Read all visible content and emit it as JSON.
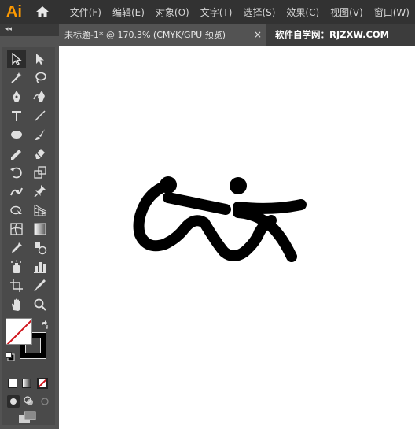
{
  "app": {
    "logo_text": "Ai",
    "home_icon": "home-icon"
  },
  "menu": [
    {
      "label": "文件(F)"
    },
    {
      "label": "编辑(E)"
    },
    {
      "label": "对象(O)"
    },
    {
      "label": "文字(T)"
    },
    {
      "label": "选择(S)"
    },
    {
      "label": "效果(C)"
    },
    {
      "label": "视图(V)"
    },
    {
      "label": "窗口(W)"
    }
  ],
  "panel": {
    "collapse_label": "◂◂"
  },
  "document_tab": {
    "title": "未标题-1* @ 170.3% (CMYK/GPU 预览)",
    "close": "×"
  },
  "watermark": {
    "text": "软件自学网：RJZXW.COM"
  },
  "colors": {
    "accent_logo": "#ff9a00",
    "menubar_bg": "#323232",
    "panel_bg": "#535353",
    "canvas_bg": "#ffffff",
    "stroke_none_red": "#d0131b",
    "artwork": "#000000"
  },
  "tools": [
    "selection-tool",
    "direct-selection-tool",
    "magic-wand-tool",
    "lasso-tool",
    "pen-tool",
    "curvature-tool",
    "type-tool",
    "line-segment-tool",
    "ellipse-tool",
    "paintbrush-tool",
    "shaper-tool",
    "eraser-tool",
    "rotate-tool",
    "scale-tool",
    "puppet-warp-tool",
    "pin-tool",
    "free-transform-tool",
    "perspective-grid-tool",
    "mesh-tool",
    "gradient-tool",
    "eyedropper-tool",
    "blend-tool",
    "symbol-sprayer-tool",
    "column-graph-tool",
    "artboard-tool",
    "slice-tool",
    "hand-tool",
    "zoom-tool"
  ]
}
